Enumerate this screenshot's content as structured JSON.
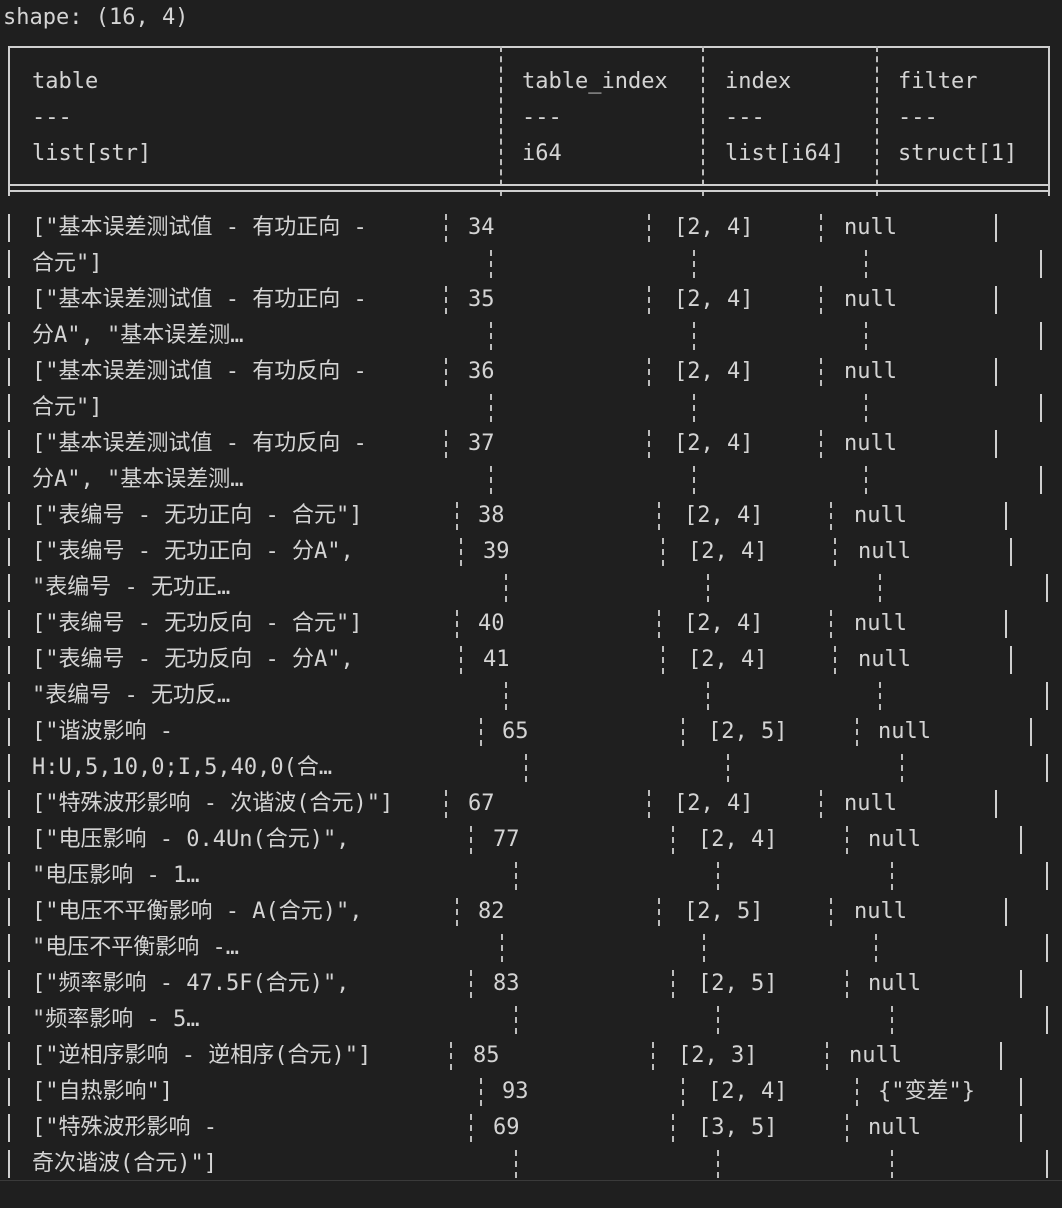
{
  "shape_text": "shape: (16, 4)",
  "columns": [
    {
      "name": "table",
      "sep": "---",
      "dtype": "list[str]"
    },
    {
      "name": "table_index",
      "sep": "---",
      "dtype": "i64"
    },
    {
      "name": "index",
      "sep": "---",
      "dtype": "list[i64]"
    },
    {
      "name": "filter",
      "sep": "---",
      "dtype": "struct[1]"
    }
  ],
  "rows": [
    {
      "table": [
        "[\"基本误差测试值 - 有功正向 -",
        "合元\"]"
      ],
      "table_index": "34",
      "index": "[2, 4]",
      "filter": "null"
    },
    {
      "table": [
        "[\"基本误差测试值 - 有功正向 -",
        "分A\", \"基本误差测…"
      ],
      "table_index": "35",
      "index": "[2, 4]",
      "filter": "null"
    },
    {
      "table": [
        "[\"基本误差测试值 - 有功反向 -",
        "合元\"]"
      ],
      "table_index": "36",
      "index": "[2, 4]",
      "filter": "null"
    },
    {
      "table": [
        "[\"基本误差测试值 - 有功反向 -",
        "分A\", \"基本误差测…"
      ],
      "table_index": "37",
      "index": "[2, 4]",
      "filter": "null"
    },
    {
      "table": [
        "[\"表编号 - 无功正向 - 合元\"]"
      ],
      "table_index": "38",
      "index": "[2, 4]",
      "filter": "null"
    },
    {
      "table": [
        "[\"表编号 - 无功正向 - 分A\",",
        "\"表编号 - 无功正…"
      ],
      "table_index": "39",
      "index": "[2, 4]",
      "filter": "null"
    },
    {
      "table": [
        "[\"表编号 - 无功反向 - 合元\"]"
      ],
      "table_index": "40",
      "index": "[2, 4]",
      "filter": "null"
    },
    {
      "table": [
        "[\"表编号 - 无功反向 - 分A\",",
        "\"表编号 - 无功反…"
      ],
      "table_index": "41",
      "index": "[2, 4]",
      "filter": "null"
    },
    {
      "table": [
        "[\"谐波影响 -",
        "H:U,5,10,0;I,5,40,0(合…"
      ],
      "table_index": "65",
      "index": "[2, 5]",
      "filter": "null"
    },
    {
      "table": [
        "[\"特殊波形影响 - 次谐波(合元)\"]"
      ],
      "table_index": "67",
      "index": "[2, 4]",
      "filter": "null"
    },
    {
      "table": [
        "[\"电压影响 - 0.4Un(合元)\",",
        "\"电压影响 - 1…"
      ],
      "table_index": "77",
      "index": "[2, 4]",
      "filter": "null"
    },
    {
      "table": [
        "[\"电压不平衡影响 - A(合元)\",",
        "\"电压不平衡影响 -…"
      ],
      "table_index": "82",
      "index": "[2, 5]",
      "filter": "null"
    },
    {
      "table": [
        "[\"频率影响 - 47.5F(合元)\",",
        "\"频率影响 - 5…"
      ],
      "table_index": "83",
      "index": "[2, 5]",
      "filter": "null"
    },
    {
      "table": [
        "[\"逆相序影响 - 逆相序(合元)\"]"
      ],
      "table_index": "85",
      "index": "[2, 3]",
      "filter": "null"
    },
    {
      "table": [
        "[\"自热影响\"]"
      ],
      "table_index": "93",
      "index": "[2, 4]",
      "filter": "{\"变差\"}"
    },
    {
      "table": [
        "[\"特殊波形影响 -",
        "奇次谐波(合元)\"]"
      ],
      "table_index": "69",
      "index": "[3, 5]",
      "filter": "null"
    }
  ],
  "colors": {
    "background": "#1f1f1f",
    "text": "#d4d4d4",
    "border": "#cfcfcf"
  }
}
